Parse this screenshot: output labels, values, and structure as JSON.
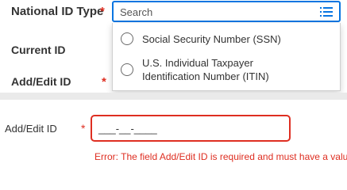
{
  "top_form": {
    "national_id_type_label": "National ID Type",
    "required_marker": "*",
    "current_id_label": "Current ID",
    "add_edit_id_label": "Add/Edit ID",
    "search": {
      "placeholder": "Search"
    },
    "options": [
      {
        "label": "Social Security Number (SSN)",
        "selected": false
      },
      {
        "label": "U.S. Individual Taxpayer Identification Number (ITIN)",
        "selected": false
      }
    ]
  },
  "bottom_form": {
    "add_edit_id_label": "Add/Edit ID",
    "required_marker": "*",
    "input_value": "___-__-____",
    "error_prefix": "Error:",
    "error_text": "The field Add/Edit ID is required and must have a value."
  },
  "colors": {
    "required": "#de2e21",
    "focus_border": "#0875e1",
    "error": "#de2e21"
  }
}
